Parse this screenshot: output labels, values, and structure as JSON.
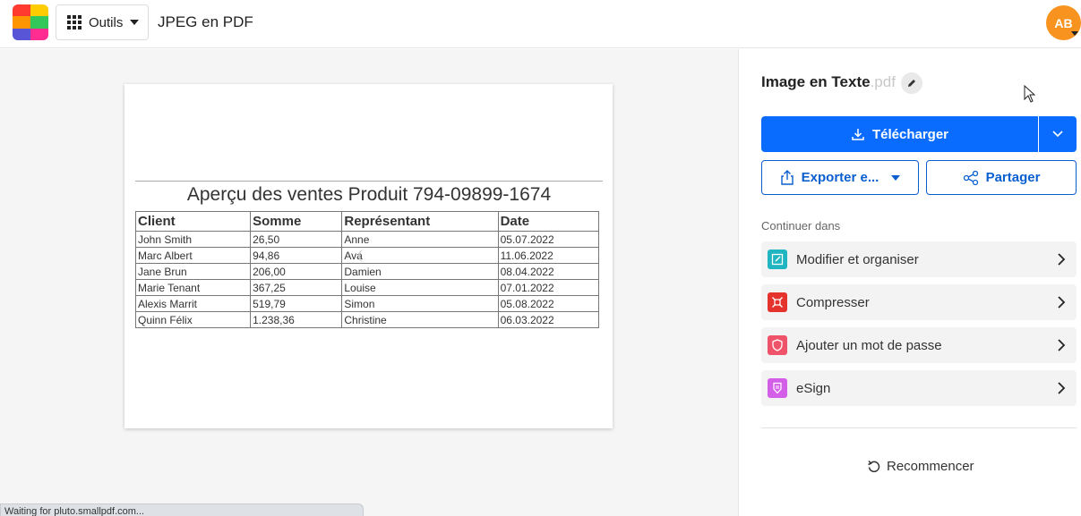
{
  "header": {
    "tools_label": "Outils",
    "page_title": "JPEG en PDF",
    "avatar_initials": "AB",
    "logo_colors": [
      "#ff3b30",
      "#ff9500",
      "#ffcc00",
      "#34c759",
      "#5856d6",
      "#ff2d92"
    ]
  },
  "document": {
    "title": "Aperçu des ventes Produit 794-09899-1674",
    "columns": [
      "Client",
      "Somme",
      "Représentant",
      "Date"
    ],
    "rows": [
      [
        "John Smith",
        "26,50",
        "Anne",
        "05.07.2022"
      ],
      [
        "Marc Albert",
        "94,86",
        "Ava",
        "11.06.2022"
      ],
      [
        "Jane Brun",
        "206,00",
        "Damien",
        "08.04.2022"
      ],
      [
        "Marie Tenant",
        "367,25",
        "Louise",
        "07.01.2022"
      ],
      [
        "Alexis Marrit",
        "519,79",
        "Simon",
        "05.08.2022"
      ],
      [
        "Quinn Félix",
        "1.238,36",
        "Christine",
        "06.03.2022"
      ]
    ]
  },
  "status_bar": {
    "text": "Waiting for pluto.smallpdf.com..."
  },
  "panel": {
    "file_name": "Image en Texte",
    "file_ext": ".pdf",
    "download_label": "Télécharger",
    "export_label": "Exporter e...",
    "share_label": "Partager",
    "continue_label": "Continuer dans",
    "tools": [
      {
        "label": "Modifier et organiser",
        "icon": "edit-organize-icon",
        "color": "#1fb5c1"
      },
      {
        "label": "Compresser",
        "icon": "compress-icon",
        "color": "#e5322d"
      },
      {
        "label": "Ajouter un mot de passe",
        "icon": "lock-shield-icon",
        "color": "#ef5369"
      },
      {
        "label": "eSign",
        "icon": "esign-icon",
        "color": "#d35ee7"
      }
    ],
    "restart_label": "Recommencer",
    "accent_color": "#0a6cff"
  }
}
